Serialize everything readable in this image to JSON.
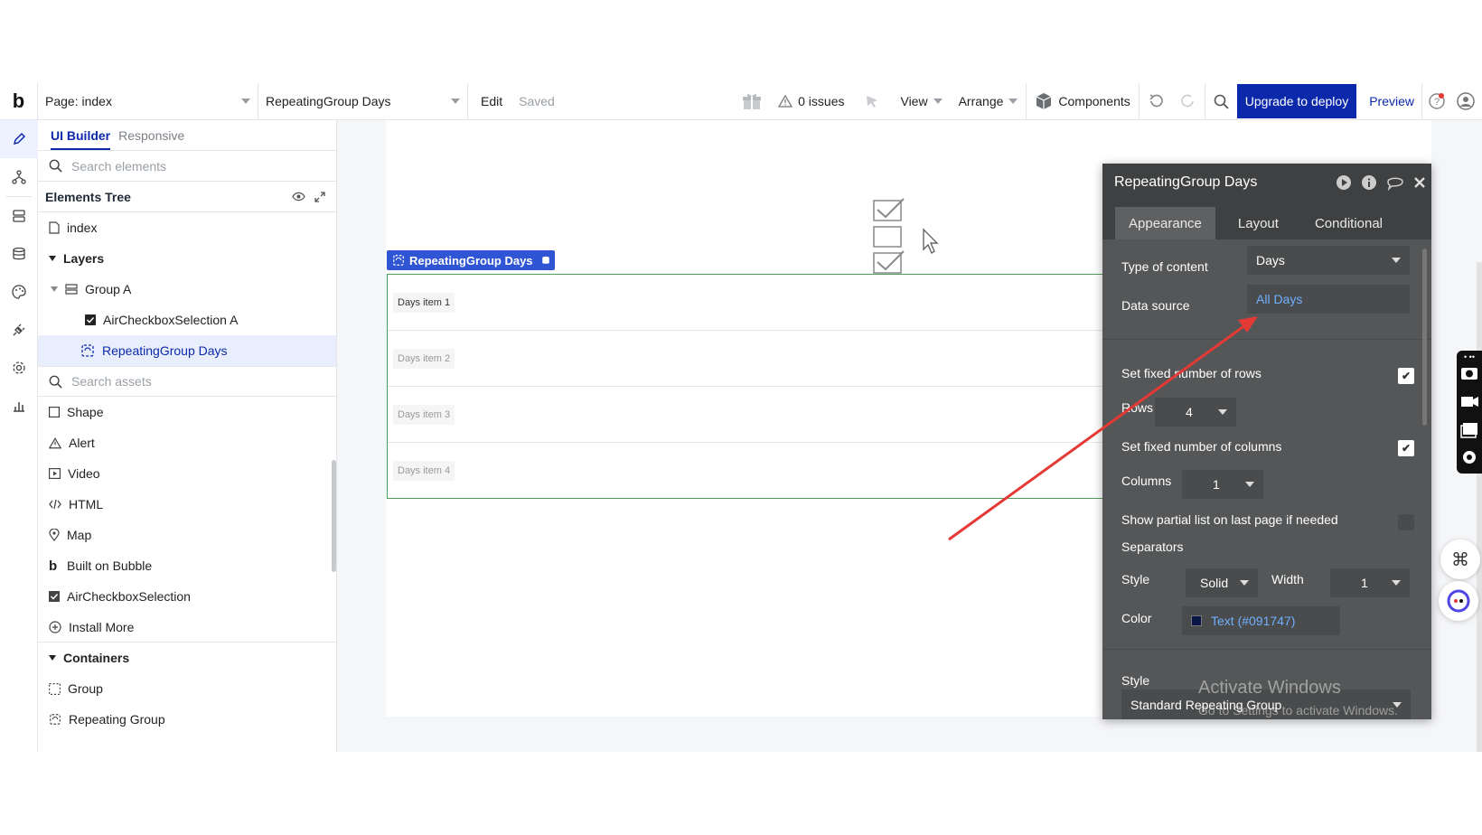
{
  "topbar": {
    "logo": "b",
    "page_dropdown": "Page: index",
    "element_dropdown": "RepeatingGroup Days",
    "edit": "Edit",
    "saved": "Saved",
    "issues": "0 issues",
    "view": "View",
    "arrange": "Arrange",
    "components": "Components",
    "upgrade": "Upgrade to deploy",
    "preview": "Preview"
  },
  "sidebar": {
    "tab_active": "UI Builder",
    "tab_other": "Responsive",
    "search_elements_placeholder": "Search elements",
    "elements_tree": "Elements Tree",
    "tree": {
      "index": "index",
      "layers": "Layers",
      "group_a": "Group A",
      "checkbox": "AirCheckboxSelection A",
      "rg": "RepeatingGroup Days"
    },
    "search_assets_placeholder": "Search assets",
    "assets": [
      "Shape",
      "Alert",
      "Video",
      "HTML",
      "Map",
      "Built on Bubble",
      "AirCheckboxSelection",
      "Install More"
    ],
    "containers_head": "Containers",
    "containers": [
      "Group",
      "Repeating Group"
    ]
  },
  "canvas": {
    "rg_label": "RepeatingGroup Days",
    "cells": [
      "Days item 1",
      "Days item 2",
      "Days item 3",
      "Days item 4"
    ]
  },
  "editor": {
    "title": "RepeatingGroup Days",
    "tabs": [
      "Appearance",
      "Layout",
      "Conditional"
    ],
    "type_label": "Type of content",
    "type_value": "Days",
    "source_label": "Data source",
    "source_value": "All Days",
    "fixed_rows_label": "Set fixed number of rows",
    "rows_label": "Rows",
    "rows_value": "4",
    "fixed_cols_label": "Set fixed number of columns",
    "cols_label": "Columns",
    "cols_value": "1",
    "partial_label": "Show partial list on last page if needed",
    "separators": "Separators",
    "style_label": "Style",
    "style_value": "Solid",
    "width_label": "Width",
    "width_value": "1",
    "color_label": "Color",
    "color_value": "Text (#091747)",
    "style2_label": "Style",
    "style2_value": "Standard Repeating Group"
  },
  "watermark": {
    "line1": "Activate Windows",
    "line2": "Go to Settings to activate Windows."
  },
  "colors": {
    "accent": "#0c29ab",
    "selection": "#2f55d4",
    "editor_bg": "#555657",
    "arrow": "#e53935"
  }
}
